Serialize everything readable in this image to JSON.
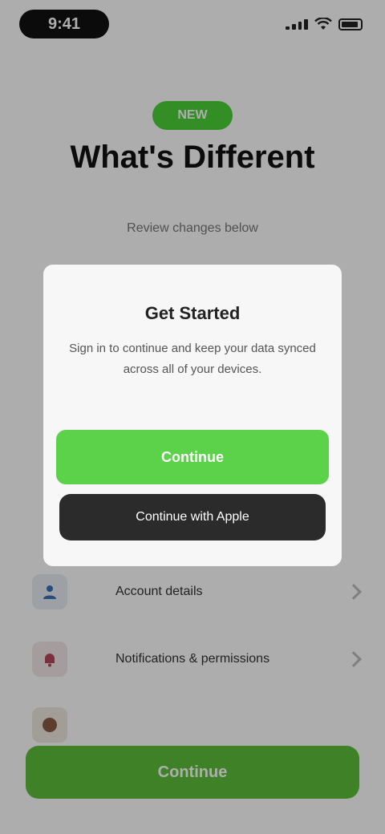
{
  "status_bar": {
    "time": "9:41"
  },
  "hero": {
    "badge": "NEW",
    "title": "What's Different",
    "subtitle": "Review changes below"
  },
  "rows": [
    {
      "label": "Account details",
      "icon": "user-icon"
    },
    {
      "label": "Notifications & permissions",
      "icon": "bell-icon"
    },
    {
      "label": "",
      "icon": "info-icon"
    }
  ],
  "cta": {
    "label": "Continue"
  },
  "dialog": {
    "title": "Get Started",
    "body": "Sign in to continue and keep your data synced across all of your devices.",
    "primary_label": "Continue",
    "secondary_label": "Continue with Apple"
  },
  "colors": {
    "accent": "#5cd14a",
    "badge": "#4cd137",
    "cta": "#5cbf3a",
    "dark_button": "#2b2b2b"
  }
}
